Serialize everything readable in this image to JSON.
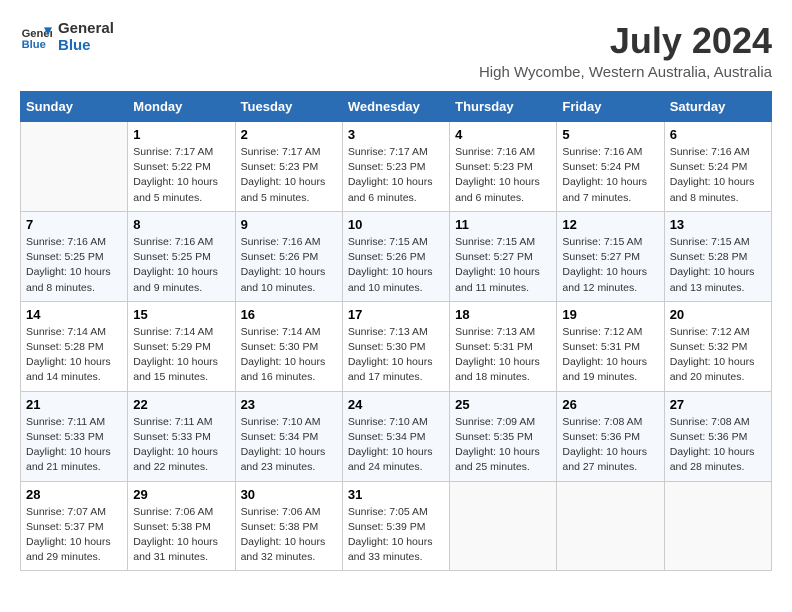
{
  "logo": {
    "text_general": "General",
    "text_blue": "Blue"
  },
  "title": "July 2024",
  "location": "High Wycombe, Western Australia, Australia",
  "weekdays": [
    "Sunday",
    "Monday",
    "Tuesday",
    "Wednesday",
    "Thursday",
    "Friday",
    "Saturday"
  ],
  "weeks": [
    [
      {
        "day": "",
        "info": ""
      },
      {
        "day": "1",
        "info": "Sunrise: 7:17 AM\nSunset: 5:22 PM\nDaylight: 10 hours\nand 5 minutes."
      },
      {
        "day": "2",
        "info": "Sunrise: 7:17 AM\nSunset: 5:23 PM\nDaylight: 10 hours\nand 5 minutes."
      },
      {
        "day": "3",
        "info": "Sunrise: 7:17 AM\nSunset: 5:23 PM\nDaylight: 10 hours\nand 6 minutes."
      },
      {
        "day": "4",
        "info": "Sunrise: 7:16 AM\nSunset: 5:23 PM\nDaylight: 10 hours\nand 6 minutes."
      },
      {
        "day": "5",
        "info": "Sunrise: 7:16 AM\nSunset: 5:24 PM\nDaylight: 10 hours\nand 7 minutes."
      },
      {
        "day": "6",
        "info": "Sunrise: 7:16 AM\nSunset: 5:24 PM\nDaylight: 10 hours\nand 8 minutes."
      }
    ],
    [
      {
        "day": "7",
        "info": "Sunrise: 7:16 AM\nSunset: 5:25 PM\nDaylight: 10 hours\nand 8 minutes."
      },
      {
        "day": "8",
        "info": "Sunrise: 7:16 AM\nSunset: 5:25 PM\nDaylight: 10 hours\nand 9 minutes."
      },
      {
        "day": "9",
        "info": "Sunrise: 7:16 AM\nSunset: 5:26 PM\nDaylight: 10 hours\nand 10 minutes."
      },
      {
        "day": "10",
        "info": "Sunrise: 7:15 AM\nSunset: 5:26 PM\nDaylight: 10 hours\nand 10 minutes."
      },
      {
        "day": "11",
        "info": "Sunrise: 7:15 AM\nSunset: 5:27 PM\nDaylight: 10 hours\nand 11 minutes."
      },
      {
        "day": "12",
        "info": "Sunrise: 7:15 AM\nSunset: 5:27 PM\nDaylight: 10 hours\nand 12 minutes."
      },
      {
        "day": "13",
        "info": "Sunrise: 7:15 AM\nSunset: 5:28 PM\nDaylight: 10 hours\nand 13 minutes."
      }
    ],
    [
      {
        "day": "14",
        "info": "Sunrise: 7:14 AM\nSunset: 5:28 PM\nDaylight: 10 hours\nand 14 minutes."
      },
      {
        "day": "15",
        "info": "Sunrise: 7:14 AM\nSunset: 5:29 PM\nDaylight: 10 hours\nand 15 minutes."
      },
      {
        "day": "16",
        "info": "Sunrise: 7:14 AM\nSunset: 5:30 PM\nDaylight: 10 hours\nand 16 minutes."
      },
      {
        "day": "17",
        "info": "Sunrise: 7:13 AM\nSunset: 5:30 PM\nDaylight: 10 hours\nand 17 minutes."
      },
      {
        "day": "18",
        "info": "Sunrise: 7:13 AM\nSunset: 5:31 PM\nDaylight: 10 hours\nand 18 minutes."
      },
      {
        "day": "19",
        "info": "Sunrise: 7:12 AM\nSunset: 5:31 PM\nDaylight: 10 hours\nand 19 minutes."
      },
      {
        "day": "20",
        "info": "Sunrise: 7:12 AM\nSunset: 5:32 PM\nDaylight: 10 hours\nand 20 minutes."
      }
    ],
    [
      {
        "day": "21",
        "info": "Sunrise: 7:11 AM\nSunset: 5:33 PM\nDaylight: 10 hours\nand 21 minutes."
      },
      {
        "day": "22",
        "info": "Sunrise: 7:11 AM\nSunset: 5:33 PM\nDaylight: 10 hours\nand 22 minutes."
      },
      {
        "day": "23",
        "info": "Sunrise: 7:10 AM\nSunset: 5:34 PM\nDaylight: 10 hours\nand 23 minutes."
      },
      {
        "day": "24",
        "info": "Sunrise: 7:10 AM\nSunset: 5:34 PM\nDaylight: 10 hours\nand 24 minutes."
      },
      {
        "day": "25",
        "info": "Sunrise: 7:09 AM\nSunset: 5:35 PM\nDaylight: 10 hours\nand 25 minutes."
      },
      {
        "day": "26",
        "info": "Sunrise: 7:08 AM\nSunset: 5:36 PM\nDaylight: 10 hours\nand 27 minutes."
      },
      {
        "day": "27",
        "info": "Sunrise: 7:08 AM\nSunset: 5:36 PM\nDaylight: 10 hours\nand 28 minutes."
      }
    ],
    [
      {
        "day": "28",
        "info": "Sunrise: 7:07 AM\nSunset: 5:37 PM\nDaylight: 10 hours\nand 29 minutes."
      },
      {
        "day": "29",
        "info": "Sunrise: 7:06 AM\nSunset: 5:38 PM\nDaylight: 10 hours\nand 31 minutes."
      },
      {
        "day": "30",
        "info": "Sunrise: 7:06 AM\nSunset: 5:38 PM\nDaylight: 10 hours\nand 32 minutes."
      },
      {
        "day": "31",
        "info": "Sunrise: 7:05 AM\nSunset: 5:39 PM\nDaylight: 10 hours\nand 33 minutes."
      },
      {
        "day": "",
        "info": ""
      },
      {
        "day": "",
        "info": ""
      },
      {
        "day": "",
        "info": ""
      }
    ]
  ]
}
